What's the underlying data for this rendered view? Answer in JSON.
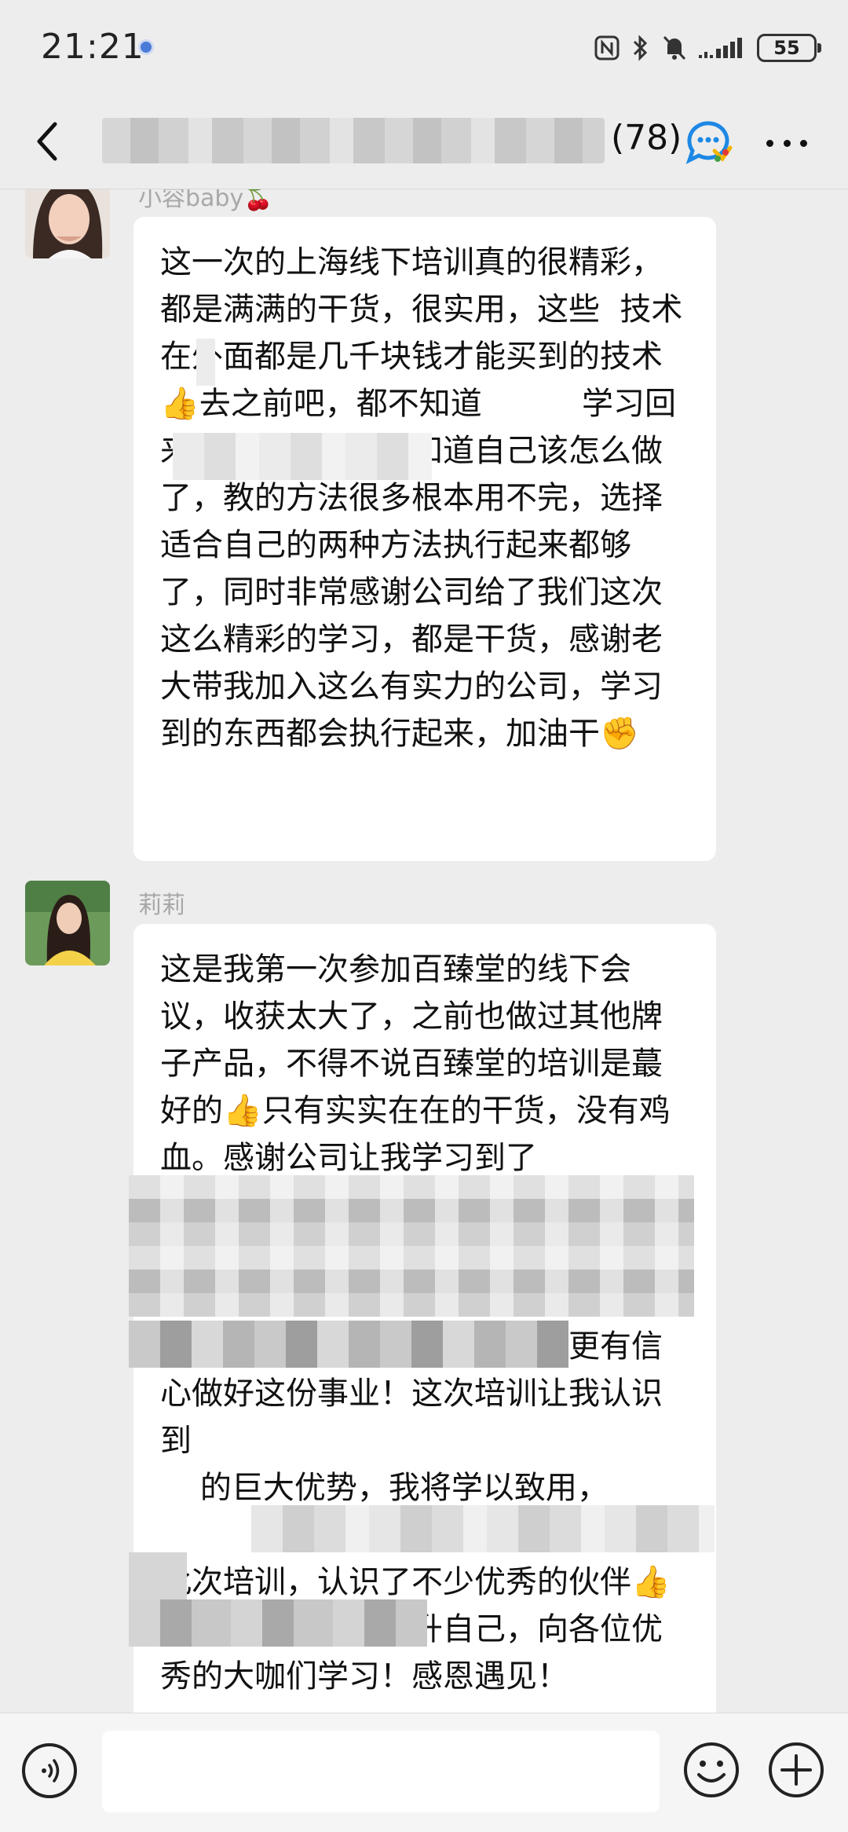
{
  "status_bar": {
    "time": "21:21",
    "battery": "55",
    "icons": [
      "nfc-icon",
      "bluetooth-icon",
      "mute-icon",
      "signal-icon",
      "battery-icon"
    ]
  },
  "header": {
    "member_count": "(78)",
    "icons": [
      "back-arrow-icon",
      "group-chat-icon",
      "more-icon"
    ]
  },
  "messages": [
    {
      "sender": "小容baby🍒",
      "text": "这一次的上海线下培训真的很精彩，都是满满的干货，很实用，这些  技术在外面都是几千块钱才能买到的技术👍去之前吧，都不知道          学习回来以后呢现在也是知道自己该怎么做了，教的方法很多根本用不完，选择适合自己的两种方法执行起来都够了，同时非常感谢公司给了我们这次这么精彩的学习，都是干货，感谢老大带我加入这么有实力的公司，学习到的东西都会执行起来，加油干✊"
    },
    {
      "sender": "莉莉",
      "text": "这是我第一次参加百臻堂的线下会议，收获太大了，之前也做过其他牌子产品，不得不说百臻堂的培训是蕞好的👍只有实实在在的干货，没有鸡血。感谢公司让我学习到了\n\n\n                    讲的\n非常细致，打开了我的思维，更有信心做好这份事业！这次培训让我认识到\n    的巨大优势，我将学以致用，\n\n此次培训，认识了不少优秀的伙伴👍我要努力学习，提升自己，向各位优秀的大咖们学习！感恩遇见！"
    }
  ],
  "colors": {
    "background": "#ededed",
    "bubble": "#ffffff",
    "sender_name": "#a8a8a8",
    "accent_blue": "#1e88e5"
  }
}
